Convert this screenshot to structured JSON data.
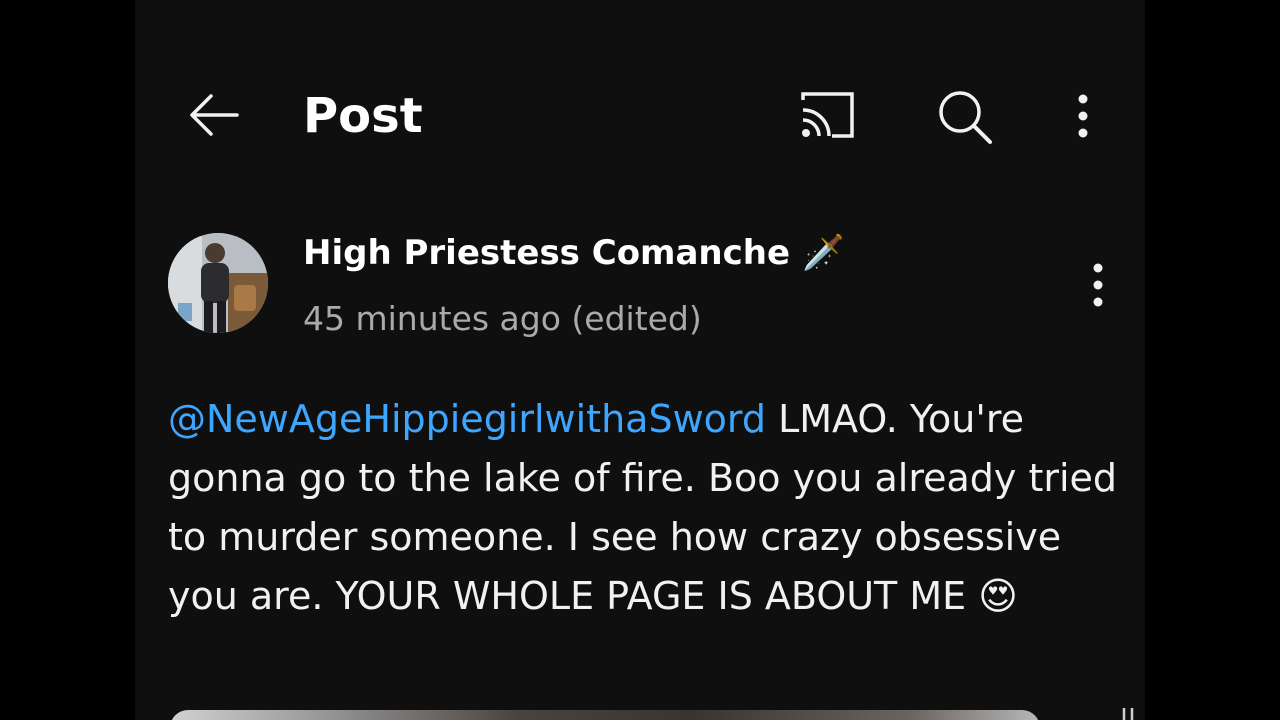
{
  "header": {
    "title": "Post",
    "icons": [
      "back-arrow-icon",
      "cast-icon",
      "search-icon",
      "more-vert-icon"
    ]
  },
  "post": {
    "author": "High Priestess Comanche",
    "author_emoji": "🗡️",
    "timestamp": "45 minutes ago (edited)",
    "mention": "@NewAgeHippiegirlwithaSword",
    "body_text": " LMAO. You're gonna go to the lake of fire. Boo you already tried to murder someone. I see how crazy obsessive you are. YOUR WHOLE PAGE IS ABOUT ME ",
    "body_emoji": "😍"
  },
  "colors": {
    "background": "#0f0f0f",
    "text": "#f1f1f1",
    "secondary_text": "#aaaaaa",
    "link": "#3ea6ff"
  }
}
